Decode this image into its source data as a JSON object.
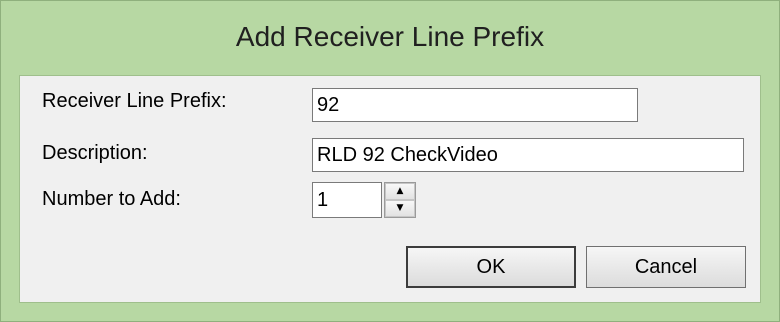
{
  "dialog": {
    "title": "Add Receiver Line Prefix"
  },
  "form": {
    "prefix_label": "Receiver Line Prefix:",
    "prefix_value": "92",
    "description_label": "Description:",
    "description_value": "RLD 92 CheckVideo",
    "number_label": "Number to Add:",
    "number_value": "1",
    "spin_up": "▲",
    "spin_down": "▼"
  },
  "buttons": {
    "ok_label": "OK",
    "cancel_label": "Cancel"
  },
  "colors": {
    "frame": "#b7d8a3",
    "client": "#f0f0f0"
  }
}
